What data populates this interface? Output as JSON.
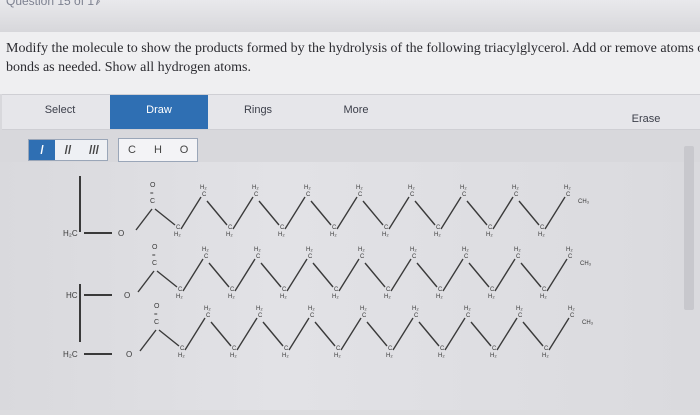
{
  "header": {
    "breadcrumb": "Question 15 of 17",
    "next_glyph": "›"
  },
  "question": {
    "text": "Modify the molecule to show the products formed by the hydrolysis of the following triacylglycerol. Add or remove atoms or bonds as needed. Show all hydrogen atoms."
  },
  "toolbar": {
    "tabs": [
      {
        "label": "Select"
      },
      {
        "label": "Draw"
      },
      {
        "label": "Rings"
      },
      {
        "label": "More"
      }
    ],
    "erase_label": "Erase",
    "bonds": [
      {
        "label": "/"
      },
      {
        "label": "//"
      },
      {
        "label": "///"
      }
    ],
    "atoms": [
      {
        "label": "C"
      },
      {
        "label": "H"
      },
      {
        "label": "O"
      }
    ]
  },
  "molecule": {
    "backbone": {
      "top_label": "H₂C",
      "middle_label": "HC",
      "bottom_label": "H₂C",
      "oxygen_label": "O"
    },
    "carbonyl_labels": {
      "oxygen": "O",
      "carbon": "C"
    },
    "chain_labels": {
      "methylene": "H₂",
      "methine": "H",
      "carbon": "C",
      "terminal_methyl": "CH₃"
    }
  },
  "colors": {
    "active_tab": "#2f6fb3",
    "bond": "#3a3a3a",
    "atom_text": "#3a3a3a"
  }
}
